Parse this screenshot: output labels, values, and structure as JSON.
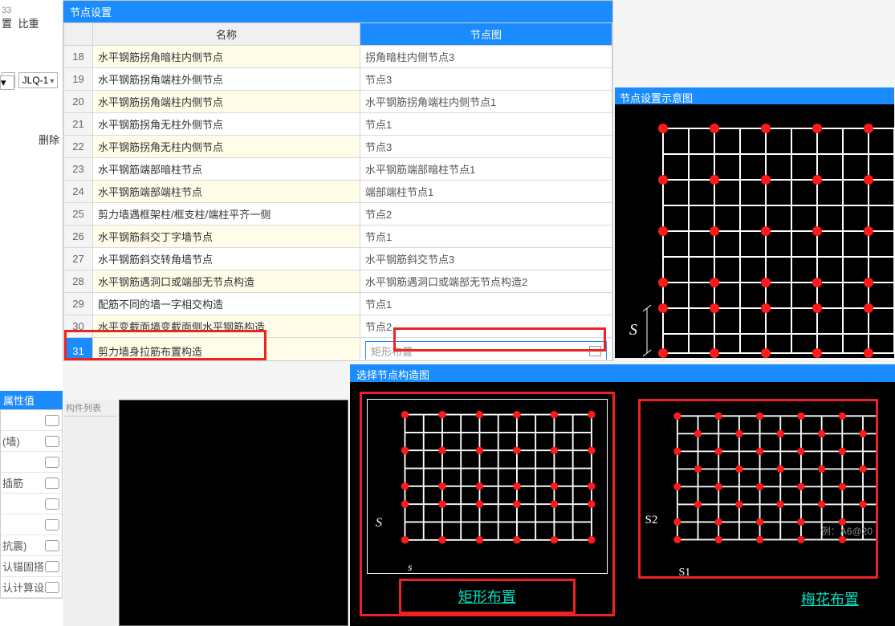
{
  "left": {
    "top1": "置",
    "top2": "比重",
    "sm": "33",
    "jlq": "JLQ-1",
    "del": "删除",
    "attr_head": "属性值",
    "attrs": [
      "",
      "(墙)",
      "",
      "插筋",
      "",
      "",
      "抗震)",
      "认锚固搭...",
      "认计算设..."
    ]
  },
  "panel": {
    "title": "节点设置",
    "col_name": "名称",
    "col_diag": "节点图",
    "rows": [
      {
        "n": "18",
        "name": "水平钢筋拐角暗柱内侧节点",
        "d": "拐角暗柱内侧节点3"
      },
      {
        "n": "19",
        "name": "水平钢筋拐角端柱外侧节点",
        "d": "节点3"
      },
      {
        "n": "20",
        "name": "水平钢筋拐角端柱内侧节点",
        "d": "水平钢筋拐角端柱内侧节点1"
      },
      {
        "n": "21",
        "name": "水平钢筋拐角无柱外侧节点",
        "d": "节点1"
      },
      {
        "n": "22",
        "name": "水平钢筋拐角无柱内侧节点",
        "d": "节点3"
      },
      {
        "n": "23",
        "name": "水平钢筋端部暗柱节点",
        "d": "水平钢筋端部暗柱节点1"
      },
      {
        "n": "24",
        "name": "水平钢筋端部端柱节点",
        "d": "端部端柱节点1"
      },
      {
        "n": "25",
        "name": "剪力墙遇框架柱/框支柱/端柱平齐一侧",
        "d": "节点2"
      },
      {
        "n": "26",
        "name": "水平钢筋斜交丁字墙节点",
        "d": "节点1"
      },
      {
        "n": "27",
        "name": "水平钢筋斜交转角墙节点",
        "d": "水平钢筋斜交节点3"
      },
      {
        "n": "28",
        "name": "水平钢筋遇洞口或端部无节点构造",
        "d": "水平钢筋遇洞口或端部无节点构造2"
      },
      {
        "n": "29",
        "name": "配筋不同的墙一字相交构造",
        "d": "节点1"
      },
      {
        "n": "30",
        "name": "水平变截面墙变截面侧水平钢筋构造",
        "d": "节点2"
      },
      {
        "n": "31",
        "name": "剪力墙身拉筋布置构造",
        "d": "矩形布置"
      }
    ]
  },
  "preview_title": "节点设置示意图",
  "select_title": "选择节点构造图",
  "thumbs": {
    "rect": "矩形布置",
    "quin": "梅花布置",
    "s": "S",
    "s1": "S1",
    "s2": "S2",
    "s_small": "s",
    "example": "例：A6@20"
  },
  "bar_head": "构件列表"
}
